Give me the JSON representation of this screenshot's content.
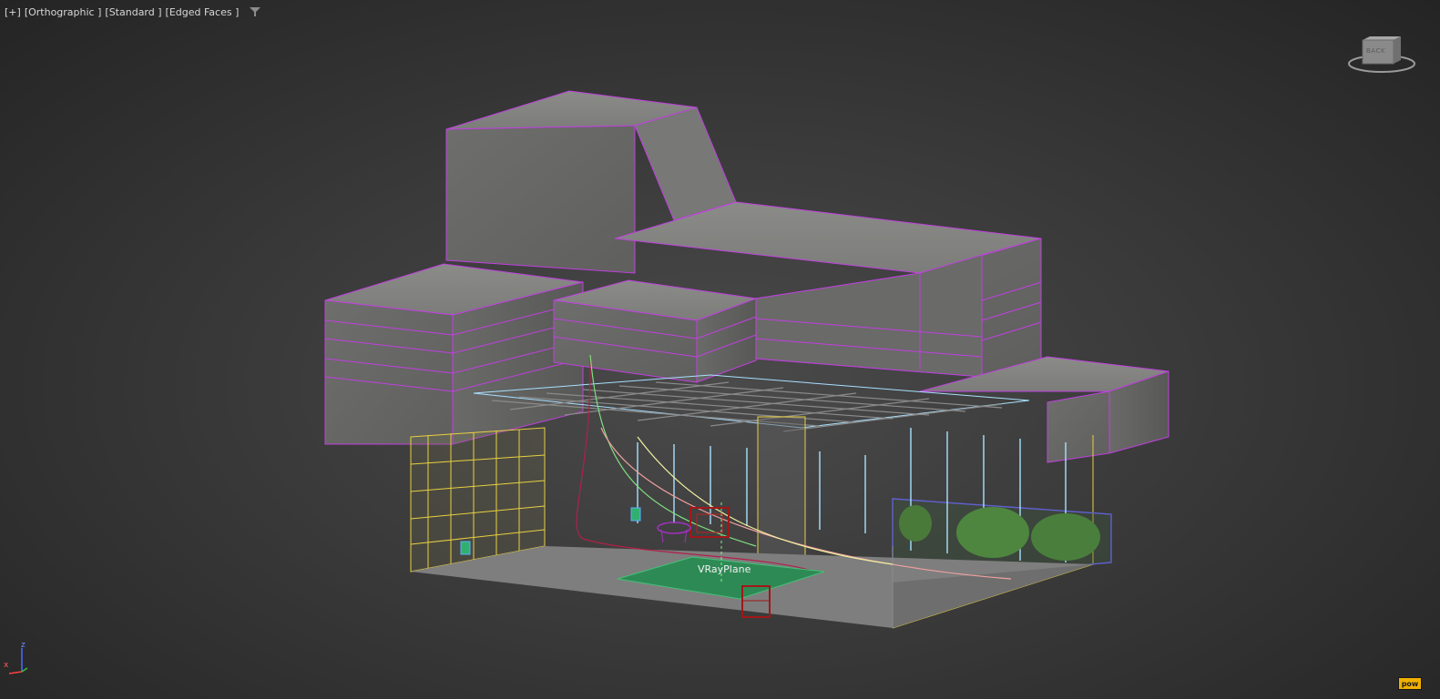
{
  "viewport": {
    "menu_plus": "[+]",
    "menu_view": "[Orthographic ]",
    "menu_shading": "[Standard ]",
    "menu_display": "[Edged Faces ]",
    "filter_icon": "funnel-icon"
  },
  "viewcube": {
    "face_label": "BACK"
  },
  "scene": {
    "object_label": "VRayPlane"
  },
  "axis_gizmo": {
    "z_label": "z",
    "x_label": "x"
  },
  "status": {
    "corner_badge": "pow"
  },
  "colors": {
    "background": "#3a3a3a",
    "concrete": "#7a7a78",
    "selection_edges": "#c040e0",
    "frame_yellow": "#e8d040",
    "frame_cyan": "#a8e0ff",
    "plane_green": "#2e8a55",
    "object_red": "#a01818"
  }
}
